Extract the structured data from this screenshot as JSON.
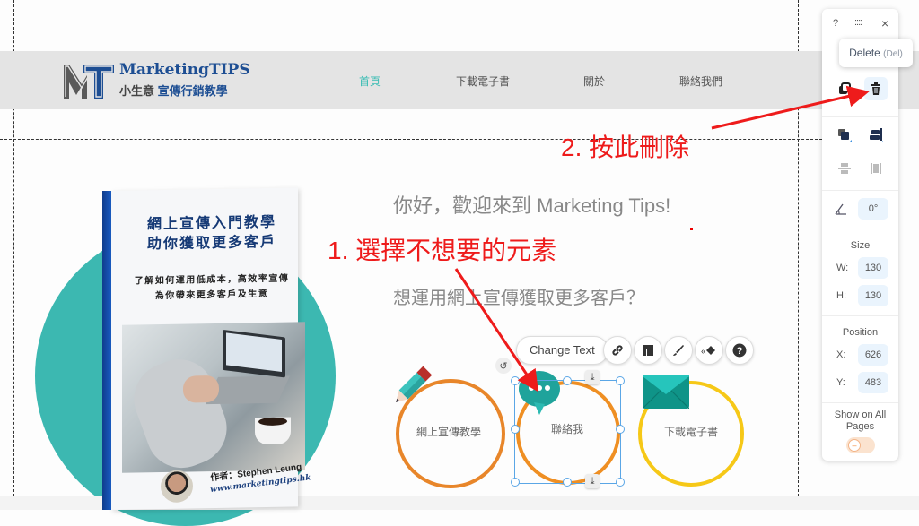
{
  "site": {
    "logo_title": "MarketingTIPS",
    "logo_sub_a": "小生意",
    "logo_sub_b": "宣傳行銷教學",
    "nav": [
      {
        "label": "首頁",
        "active": true
      },
      {
        "label": "下載電子書",
        "active": false
      },
      {
        "label": "關於",
        "active": false
      },
      {
        "label": "聯絡我們",
        "active": false
      }
    ],
    "book": {
      "title_line1": "網上宣傳入門教學",
      "title_line2": "助你獲取更多客戶",
      "sub_line1": "了解如何運用低成本，高效率宣傳",
      "sub_line2": "為你帶來更多客戶及生意",
      "author": "作者：Stephen Leung",
      "website": "www.marketingtips.hk"
    },
    "greeting": "你好，歡迎來到 Marketing Tips!",
    "question": "想運用網上宣傳獲取更多客戶？",
    "rings": [
      {
        "label": "網上宣傳教學",
        "icon": "pencil-icon",
        "color": "#e8862a"
      },
      {
        "label": "聯絡我",
        "icon": "chat-bubble-icon",
        "color": "#ef8f23"
      },
      {
        "label": "下載電子書",
        "icon": "envelope-icon",
        "color": "#f6c817"
      }
    ]
  },
  "annotations": {
    "step1": "1. 選擇不想要的元素",
    "step2": "2. 按此刪除",
    "color": "#ee1b1b"
  },
  "element_toolbar": {
    "change_text": "Change Text",
    "buttons": [
      "link-icon",
      "layout-icon",
      "brush-icon",
      "animation-icon",
      "help-icon"
    ]
  },
  "panel": {
    "help": "?",
    "drag": "::::",
    "close": "×",
    "tooltip_label": "Delete",
    "tooltip_shortcut": "(Del)",
    "rotation": "0°",
    "size_label": "Size",
    "w_label": "W:",
    "w_value": "130",
    "h_label": "H:",
    "h_value": "130",
    "position_label": "Position",
    "x_label": "X:",
    "x_value": "626",
    "y_label": "Y:",
    "y_value": "483",
    "show_all_label": "Show on All Pages",
    "show_all_on": false
  }
}
